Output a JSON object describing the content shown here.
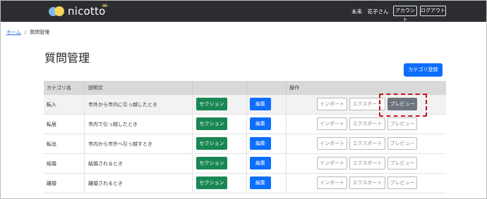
{
  "header": {
    "logo_text": "nicotto",
    "user_name": "未来　花子さん",
    "account_label": "アカウント",
    "logout_label": "ログアウト"
  },
  "breadcrumb": {
    "home": "ホーム",
    "separator": "/",
    "current": "質問管理"
  },
  "page": {
    "title": "質問管理",
    "add_button": "カテゴリ登録"
  },
  "table": {
    "headers": {
      "category": "カテゴリ名",
      "description": "説明文",
      "operations": "操作"
    },
    "rows": [
      {
        "category": "転入",
        "description": "市外から市内に引っ越したとき",
        "section": "セクション",
        "edit": "編集",
        "import": "インポート",
        "export": "エクスポート",
        "preview": "プレビュー"
      },
      {
        "category": "転居",
        "description": "市内で引っ越したとき",
        "section": "セクション",
        "edit": "編集",
        "import": "インポート",
        "export": "エクスポート",
        "preview": "プレビュー"
      },
      {
        "category": "転出",
        "description": "市内から市外へ引っ越すとき",
        "section": "セクション",
        "edit": "編集",
        "import": "インポート",
        "export": "エクスポート",
        "preview": "プレビュー"
      },
      {
        "category": "結婚",
        "description": "結婚されるとき",
        "section": "セクション",
        "edit": "編集",
        "import": "インポート",
        "export": "エクスポート",
        "preview": "プレビュー"
      },
      {
        "category": "離婚",
        "description": "離婚されるとき",
        "section": "セクション",
        "edit": "編集",
        "import": "インポート",
        "export": "エクスポート",
        "preview": "プレビュー"
      }
    ]
  },
  "colors": {
    "topbar": "#2b2d30",
    "primary": "#0d6efd",
    "success": "#198754",
    "secondary": "#6c757d",
    "highlight": "#c0141b"
  },
  "highlight": "preview-button-row-1"
}
